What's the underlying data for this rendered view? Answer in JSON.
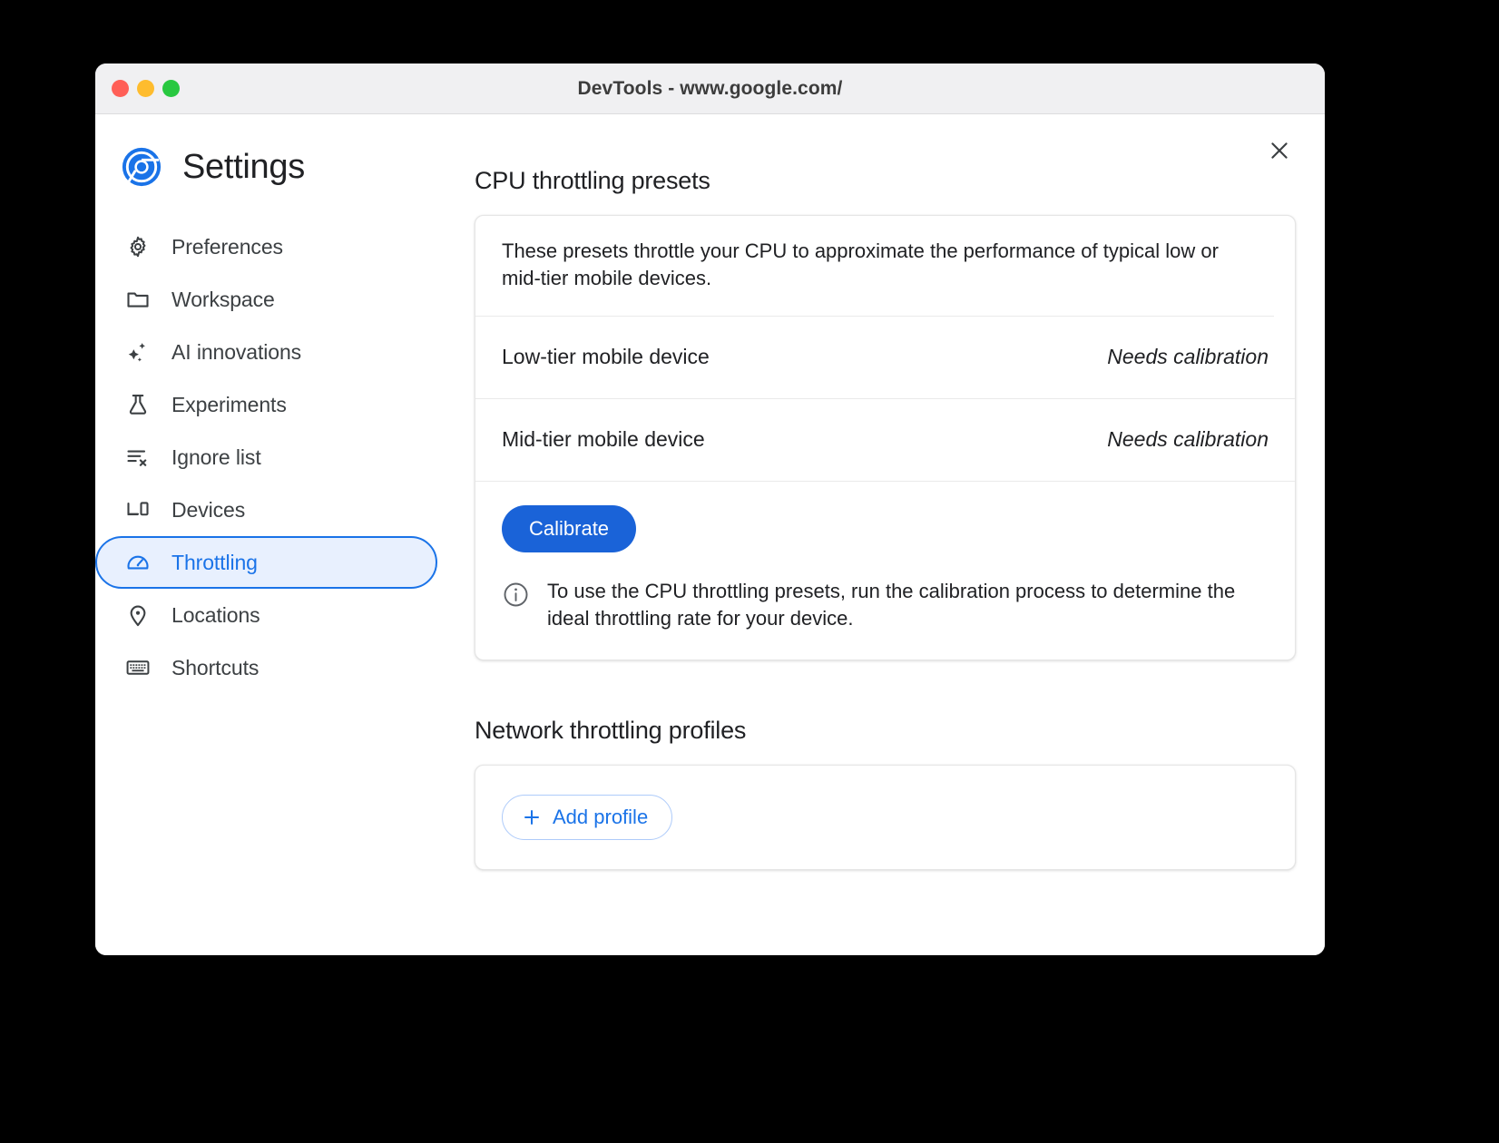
{
  "window": {
    "title": "DevTools - www.google.com/",
    "traffic_lights": [
      "close",
      "minimize",
      "maximize"
    ],
    "close_dialog_label": "Close"
  },
  "settings": {
    "title": "Settings",
    "logo": "chrome-logo"
  },
  "sidebar": {
    "items": [
      {
        "label": "Preferences",
        "icon": "gear-icon",
        "selected": false
      },
      {
        "label": "Workspace",
        "icon": "folder-icon",
        "selected": false
      },
      {
        "label": "AI innovations",
        "icon": "sparkle-icon",
        "selected": false
      },
      {
        "label": "Experiments",
        "icon": "flask-icon",
        "selected": false
      },
      {
        "label": "Ignore list",
        "icon": "list-x-icon",
        "selected": false
      },
      {
        "label": "Devices",
        "icon": "devices-icon",
        "selected": false
      },
      {
        "label": "Throttling",
        "icon": "speedometer-icon",
        "selected": true
      },
      {
        "label": "Locations",
        "icon": "location-pin-icon",
        "selected": false
      },
      {
        "label": "Shortcuts",
        "icon": "keyboard-icon",
        "selected": false
      }
    ]
  },
  "cpu_section": {
    "heading": "CPU throttling presets",
    "description": "These presets throttle your CPU to approximate the performance of typical low or mid-tier mobile devices.",
    "presets": [
      {
        "name": "Low-tier mobile device",
        "status": "Needs calibration"
      },
      {
        "name": "Mid-tier mobile device",
        "status": "Needs calibration"
      }
    ],
    "calibrate_label": "Calibrate",
    "info_text": "To use the CPU throttling presets, run the calibration process to determine the ideal throttling rate for your device.",
    "info_icon": "info-icon"
  },
  "network_section": {
    "heading": "Network throttling profiles",
    "add_profile_label": "Add profile",
    "add_icon": "plus-icon"
  },
  "colors": {
    "accent": "#1a73e8",
    "button_blue": "#1a63d8",
    "selected_bg": "#e8f0fe",
    "text": "#202124",
    "titlebar_bg": "#f0f0f2"
  }
}
